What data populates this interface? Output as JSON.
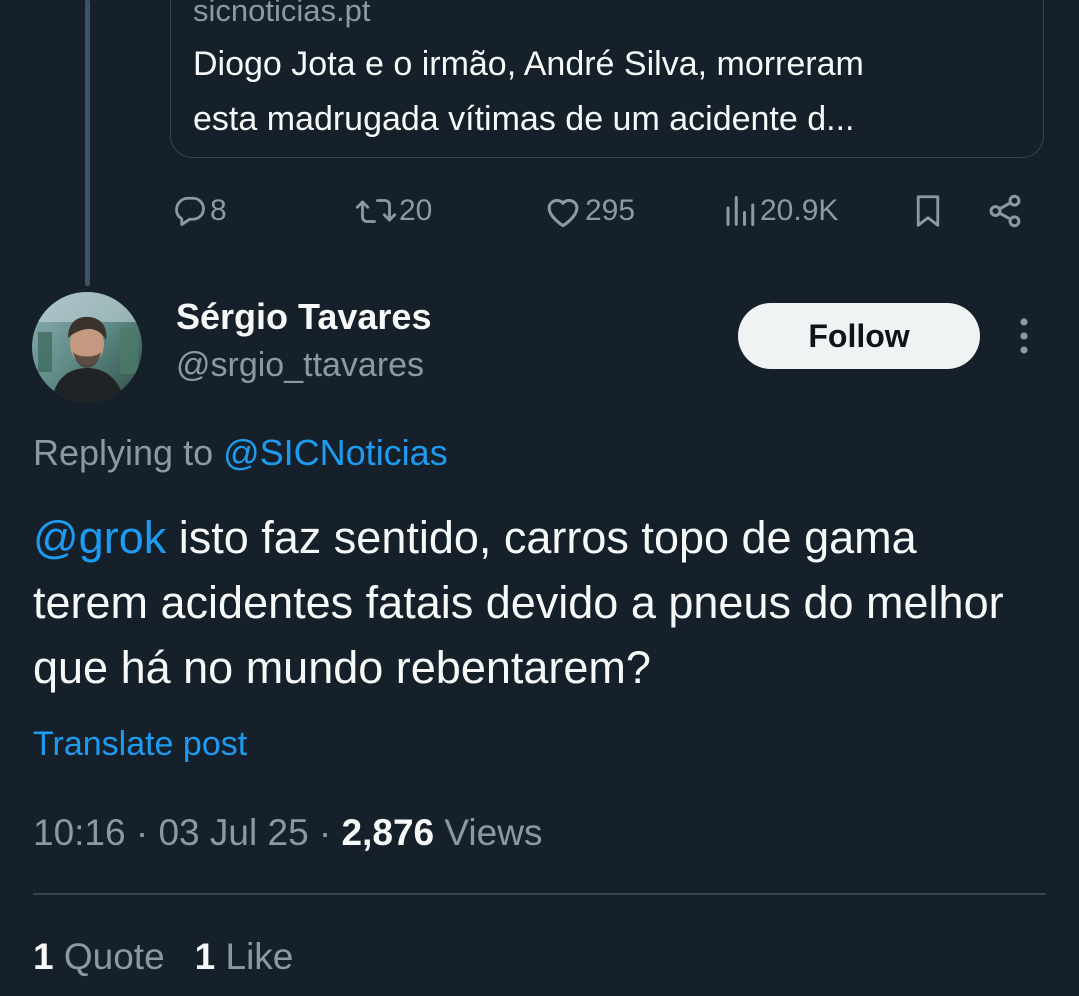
{
  "quoted_card": {
    "domain": "sicnoticias.pt",
    "text_line1": "Diogo Jota e o irmão, André Silva, morreram",
    "text_line2": "esta madrugada vítimas de um acidente d..."
  },
  "parent_actions": {
    "replies": "8",
    "reposts": "20",
    "likes": "295",
    "views": "20.9K",
    "icons": [
      "reply-icon",
      "repost-icon",
      "like-icon",
      "views-icon",
      "bookmark-icon",
      "share-icon"
    ]
  },
  "author": {
    "name": "Sérgio Tavares",
    "handle": "@srgio_ttavares"
  },
  "follow_label": "Follow",
  "replying": {
    "prefix": "Replying to ",
    "mention": "@SICNoticias"
  },
  "post": {
    "mention": "@grok",
    "text": " isto faz sentido, carros topo de gama terem acidentes fatais devido a pneus do melhor que há no mundo rebentarem?"
  },
  "translate_label": "Translate post",
  "meta": {
    "time": "10:16",
    "sep1": " · ",
    "date": "03 Jul 25",
    "sep2": " · ",
    "views_count": "2,876",
    "views_label": " Views"
  },
  "stats": {
    "quotes_count": "1",
    "quotes_label": " Quote",
    "likes_count": "1",
    "likes_label": " Like"
  },
  "colors": {
    "background": "#15202b",
    "accent": "#1d9bf0",
    "secondary_text": "#8b98a5",
    "primary_text": "#f7f9f9"
  }
}
